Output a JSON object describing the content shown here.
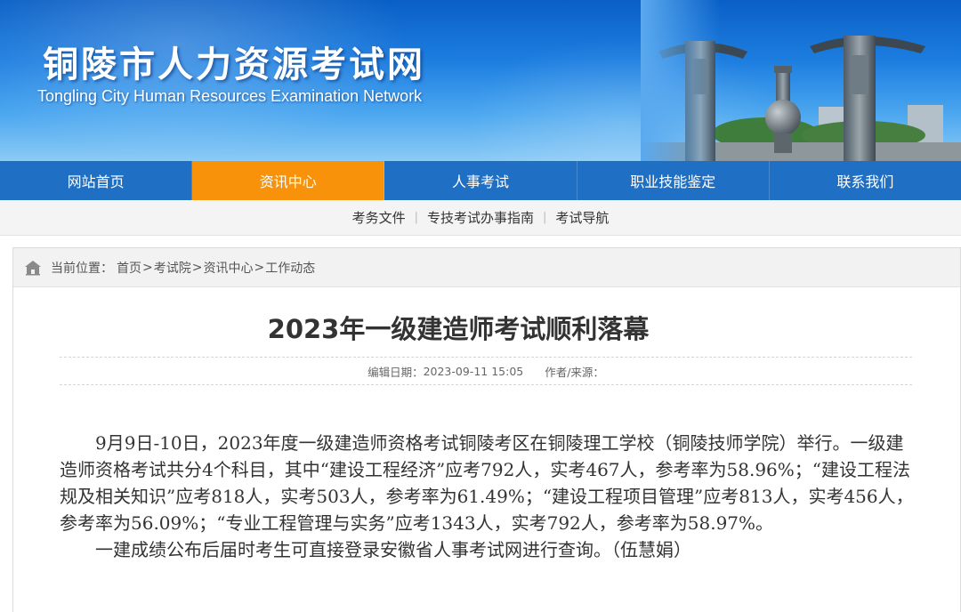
{
  "header": {
    "site_title": "铜陵市人力资源考试网",
    "site_subtitle": "Tongling City Human Resources Examination Network"
  },
  "main_nav": {
    "items": [
      {
        "label": "网站首页"
      },
      {
        "label": "资讯中心"
      },
      {
        "label": "人事考试"
      },
      {
        "label": "职业技能鉴定"
      },
      {
        "label": "联系我们"
      }
    ],
    "active_index": 1
  },
  "sub_nav": {
    "items": [
      {
        "label": "考务文件"
      },
      {
        "label": "专技考试办事指南"
      },
      {
        "label": "考试导航"
      }
    ],
    "separator": "|"
  },
  "breadcrumb": {
    "label": "当前位置：",
    "items": [
      "首页",
      "考试院",
      "资讯中心",
      "工作动态"
    ],
    "separator": ">"
  },
  "article": {
    "title": "2023年一级建造师考试顺利落幕",
    "edit_date_label": "编辑日期：",
    "edit_date": "2023-09-11 15:05",
    "author_label": "作者/来源：",
    "author": "",
    "paragraphs": [
      "9月9日-10日，2023年度一级建造师资格考试铜陵考区在铜陵理工学校（铜陵技师学院）举行。一级建造师资格考试共分4个科目，其中“建设工程经济”应考792人，实考467人，参考率为58.96%；“建设工程法规及相关知识”应考818人，实考503人，参考率为61.49%；“建设工程项目管理”应考813人，实考456人，参考率为56.09%；“专业工程管理与实务”应考1343人，实考792人，参考率为58.97%。",
      "一建成绩公布后届时考生可直接登录安徽省人事考试网进行查询。（伍慧娟）"
    ]
  },
  "colors": {
    "nav_bg": "#1f6fc4",
    "nav_active": "#f7920a",
    "banner_top": "#0a5fc6",
    "banner_bottom": "#8ccbf6"
  },
  "icons": {
    "breadcrumb": "home-icon"
  }
}
